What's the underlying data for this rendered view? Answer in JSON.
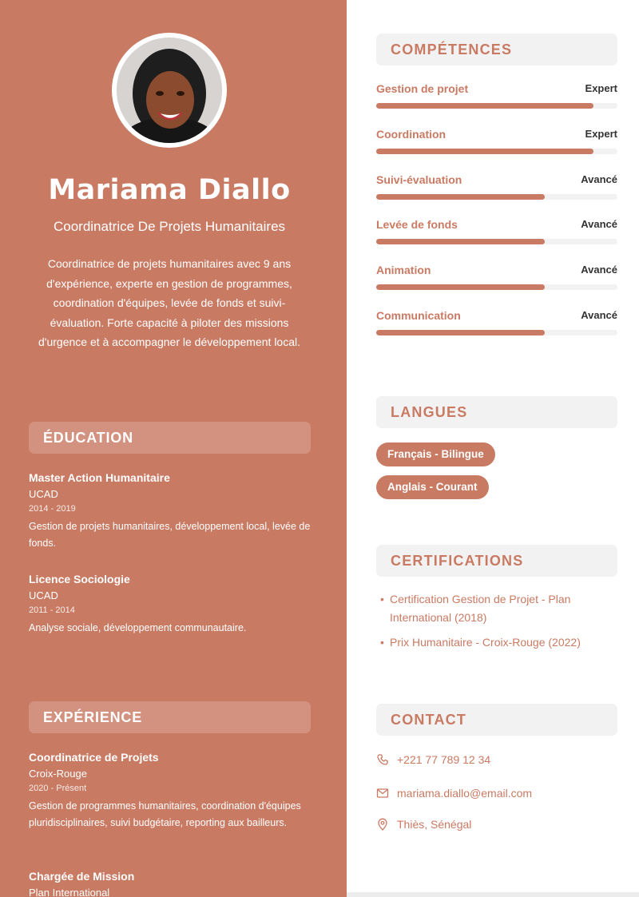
{
  "profile": {
    "name": "Mariama Diallo",
    "role": "Coordinatrice De Projets Humanitaires",
    "summary": "Coordinatrice de projets humanitaires avec 9 ans d'expérience, experte en gestion de programmes, coordination d'équipes, levée de fonds et suivi-évaluation. Forte capacité à piloter des missions d'urgence et à accompagner le développement local."
  },
  "education": {
    "title": "ÉDUCATION",
    "items": [
      {
        "title": "Master Action Humanitaire",
        "org": "UCAD",
        "dates": "2014 - 2019",
        "desc": "Gestion de projets humanitaires, développement local, levée de fonds."
      },
      {
        "title": "Licence Sociologie",
        "org": "UCAD",
        "dates": "2011 - 2014",
        "desc": "Analyse sociale, développement communautaire."
      }
    ]
  },
  "experience": {
    "title": "EXPÉRIENCE",
    "items": [
      {
        "title": "Coordinatrice de Projets",
        "org": "Croix-Rouge",
        "dates": "2020 - Présent",
        "desc": "Gestion de programmes humanitaires, coordination d'équipes pluridisciplinaires, suivi budgétaire, reporting aux bailleurs."
      },
      {
        "title": "Chargée de Mission",
        "org": "Plan International"
      }
    ]
  },
  "skills": {
    "title": "COMPÉTENCES",
    "items": [
      {
        "name": "Gestion de projet",
        "level": "Expert",
        "value": 0.9
      },
      {
        "name": "Coordination",
        "level": "Expert",
        "value": 0.9
      },
      {
        "name": "Suivi-évaluation",
        "level": "Avancé",
        "value": 0.7
      },
      {
        "name": "Levée de fonds",
        "level": "Avancé",
        "value": 0.7
      },
      {
        "name": "Animation",
        "level": "Avancé",
        "value": 0.7
      },
      {
        "name": "Communication",
        "level": "Avancé",
        "value": 0.7
      }
    ]
  },
  "languages": {
    "title": "LANGUES",
    "items": [
      "Français - Bilingue",
      "Anglais - Courant"
    ]
  },
  "certifications": {
    "title": "CERTIFICATIONS",
    "items": [
      "Certification Gestion de Projet - Plan International (2018)",
      "Prix Humanitaire - Croix-Rouge (2022)"
    ]
  },
  "contact": {
    "title": "CONTACT",
    "phone": "+221 77 789 12 34",
    "email": "mariama.diallo@email.com",
    "location": "Thiès, Sénégal",
    "icons": [
      "phone-icon",
      "mail-icon",
      "location-pin-icon"
    ]
  },
  "colors": {
    "accent": "#c97a63",
    "panel": "#f3f2f2",
    "text_dark": "#333333"
  }
}
